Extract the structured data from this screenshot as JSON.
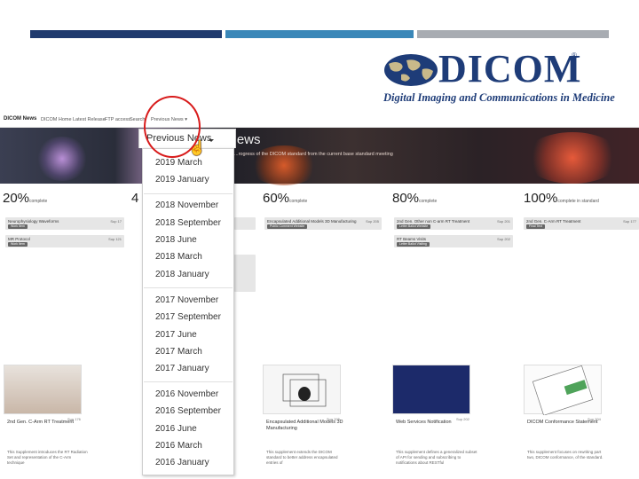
{
  "logo": {
    "wordmark": "DICOM",
    "registered": "®",
    "tagline": "Digital Imaging and Communications in Medicine"
  },
  "navbar": {
    "brand": "DICOM News",
    "items": [
      "DICOM Home",
      "Latest Release",
      "FTP access",
      "Search",
      "Previous News ▾"
    ]
  },
  "hero": {
    "title": "News",
    "subtitle": "...rogress of the DICOM standard from the current base standard meeting"
  },
  "progress": [
    {
      "pct": "20%",
      "word": "complete"
    },
    {
      "pct": "4",
      "word": ""
    },
    {
      "pct": "60%",
      "word": "complete"
    },
    {
      "pct": "80%",
      "word": "complete"
    },
    {
      "pct": "100%",
      "word": "complete in standard"
    }
  ],
  "table_cells": [
    {
      "title": "Neurophysiology Waveforms",
      "date": "Sup 17",
      "tag": "Work Item",
      "color": "#6f6f6f"
    },
    {
      "title": "Encapsulated Additional Models 3D Manufacturing",
      "date": "Sup 205",
      "tag": "Public Comment Website",
      "color": "#6f6f6f"
    },
    {
      "title": "2nd Gen. Other non C-arm RT Treatment",
      "date": "Sup 201",
      "tag": "Letter Ballot Website",
      "color": "#6f6f6f"
    },
    {
      "title": "2nd Gen. C-Arm RT Treatment",
      "date": "Sup 177",
      "tag": "Final Text",
      "color": "#6f6f6f"
    },
    {
      "title": "MR Protocol",
      "date": "Sup 121",
      "tag": "Work Item",
      "color": "#6f6f6f"
    },
    {
      "title": "RT Beams Visits",
      "date": "Sup 202",
      "tag": "Letter Ballot Visiting",
      "color": "#6f6f6f"
    }
  ],
  "cards": [
    {
      "title": "2nd Gen. C-Arm RT Treatment",
      "date": "Sup 176",
      "text": "This Supplement introduces the RT Radiation Set and representation of the C-Arm technique"
    },
    {
      "title": "Encapsulated Additional Models 3D Manufacturing",
      "date": "Sup 205",
      "text": "This supplement extends the DICOM standard to better address encapsulated entries of"
    },
    {
      "title": "Web Services Notification",
      "date": "Sup 202",
      "text": "This supplement defines a generalized subset of API for sending and subscribing to notifications about RESTful"
    },
    {
      "title": "DICOM Conformance Statement",
      "date": "Sup 204",
      "text": "This supplement focuses on rewriting part two, DICOM conformance, of the standard."
    }
  ],
  "dropdown": {
    "label": "Previous News",
    "items": [
      "2019 March",
      "2019 January",
      "2018 November",
      "2018 September",
      "2018 June",
      "2018 March",
      "2018 January",
      "2017 November",
      "2017 September",
      "2017 June",
      "2017 March",
      "2017 January",
      "2016 November",
      "2016 September",
      "2016 June",
      "2016 March",
      "2016 January"
    ]
  },
  "colors": {
    "bar1": "#1f3a6e",
    "bar2": "#3a87b8",
    "bar3": "#a8acb2",
    "brand": "#1e3c78",
    "annotation": "#d81b1b"
  }
}
